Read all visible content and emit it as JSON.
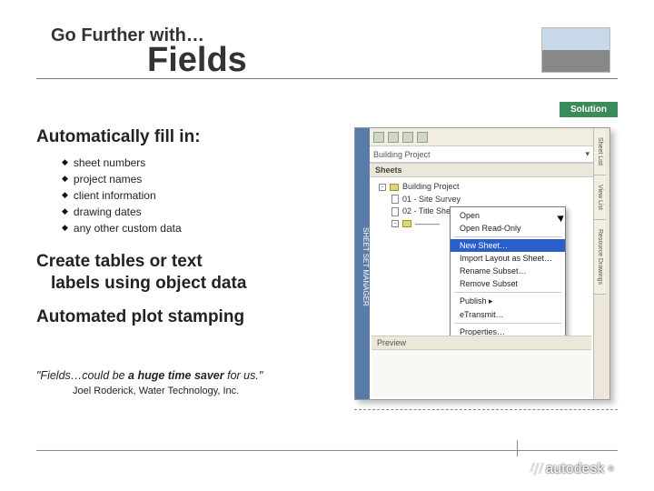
{
  "header": {
    "pre_title": "Go Further with…",
    "title": "Fields"
  },
  "solution_tab": "Solution",
  "section1_heading": "Automatically fill in:",
  "bullets": [
    "sheet numbers",
    "project names",
    "client information",
    "drawing dates",
    "any other custom data"
  ],
  "section2_line1": "Create tables or text",
  "section2_line2": "labels using object data",
  "section3_heading": "Automated plot stamping",
  "quote_prefix": "\"Fields…could be ",
  "quote_bold": "a huge time saver",
  "quote_suffix": " for us.\"",
  "attribution": "Joel Roderick, Water Technology, Inc.",
  "panel": {
    "vstrip": "SHEET SET MANAGER",
    "address": "Building Project",
    "section_label": "Sheets",
    "tree": {
      "root": "Building Project",
      "items": [
        "01 - Site Survey",
        "02 - Title Sheet"
      ],
      "subset_label": "———"
    },
    "vtabs": [
      "Sheet List",
      "View List",
      "Resource Drawings"
    ],
    "ctx": {
      "open": "Open",
      "open_ro": "Open Read-Only",
      "new_sheet": "New Sheet…",
      "import": "Import Layout as Sheet…",
      "rename": "Rename Subset…",
      "remove": "Remove Subset",
      "publish": "Publish  ▸",
      "etransmit": "eTransmit…",
      "properties": "Properties…"
    },
    "preview_label": "Preview"
  },
  "footer_logo": "autodesk"
}
